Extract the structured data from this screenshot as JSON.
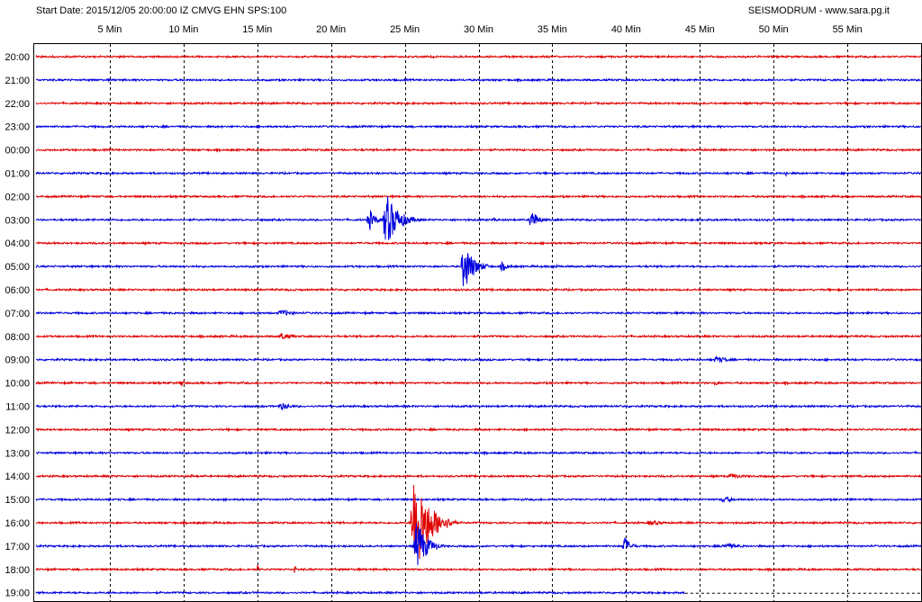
{
  "header": {
    "start_info": "Start Date: 2015/12/05 20:00:00 IZ CMVG EHN SPS:100",
    "source": "SEISMODRUM - www.sara.pg.it"
  },
  "colors": {
    "even_trace": "#e00000",
    "odd_trace": "#0000dd",
    "grid": "#000000",
    "frame": "#000000",
    "background": "#ffffff"
  },
  "chart_data": {
    "type": "line",
    "title": "",
    "minute_ticks": [
      "5 Min",
      "10 Min",
      "15 Min",
      "20 Min",
      "25 Min",
      "30 Min",
      "35 Min",
      "40 Min",
      "45 Min",
      "50 Min",
      "55 Min"
    ],
    "minute_values": [
      5,
      10,
      15,
      20,
      25,
      30,
      35,
      40,
      45,
      50,
      55
    ],
    "x_range_min": [
      0,
      60
    ],
    "grid": "dashed vertical lines every 5 minutes",
    "rows": [
      "20:00",
      "21:00",
      "22:00",
      "23:00",
      "00:00",
      "01:00",
      "02:00",
      "03:00",
      "04:00",
      "05:00",
      "06:00",
      "07:00",
      "08:00",
      "09:00",
      "10:00",
      "11:00",
      "12:00",
      "13:00",
      "14:00",
      "15:00",
      "16:00",
      "17:00",
      "18:00",
      "19:00"
    ],
    "row_color_pattern": "alternating red / blue starting with red",
    "last_row_recorded_until_min": 44,
    "events": [
      {
        "row": "01:00",
        "minute": 50.8,
        "amplitude": 4,
        "duration_min": 0.4
      },
      {
        "row": "03:00",
        "minute": 22.5,
        "amplitude": 14,
        "duration_min": 1.2
      },
      {
        "row": "03:00",
        "minute": 23.6,
        "amplitude": 30,
        "duration_min": 2.5
      },
      {
        "row": "03:00",
        "minute": 31.0,
        "amplitude": 3,
        "duration_min": 0.8
      },
      {
        "row": "03:00",
        "minute": 33.5,
        "amplitude": 14,
        "duration_min": 1.2
      },
      {
        "row": "05:00",
        "minute": 28.9,
        "amplitude": 29,
        "duration_min": 2.0
      },
      {
        "row": "05:00",
        "minute": 31.5,
        "amplitude": 6,
        "duration_min": 1.2
      },
      {
        "row": "05:00",
        "minute": 35.0,
        "amplitude": 2,
        "duration_min": 2.5
      },
      {
        "row": "07:00",
        "minute": 16.5,
        "amplitude": 4,
        "duration_min": 2.5
      },
      {
        "row": "08:00",
        "minute": 16.5,
        "amplitude": 4,
        "duration_min": 2.5
      },
      {
        "row": "09:00",
        "minute": 46.0,
        "amplitude": 4,
        "duration_min": 2.5
      },
      {
        "row": "10:00",
        "minute": 9.8,
        "amplitude": 5,
        "duration_min": 0.8
      },
      {
        "row": "10:00",
        "minute": 46.0,
        "amplitude": 3,
        "duration_min": 1.0
      },
      {
        "row": "11:00",
        "minute": 16.5,
        "amplitude": 4,
        "duration_min": 2.5
      },
      {
        "row": "11:00",
        "minute": 40.0,
        "amplitude": 4,
        "duration_min": 0.3
      },
      {
        "row": "14:00",
        "minute": 10.5,
        "amplitude": 4,
        "duration_min": 0.3
      },
      {
        "row": "14:00",
        "minute": 47.0,
        "amplitude": 3,
        "duration_min": 3.0
      },
      {
        "row": "15:00",
        "minute": 46.5,
        "amplitude": 4,
        "duration_min": 2.0
      },
      {
        "row": "16:00",
        "minute": 25.5,
        "amplitude": 60,
        "duration_min": 3.0
      },
      {
        "row": "16:00",
        "minute": 41.5,
        "amplitude": 3,
        "duration_min": 3.0
      },
      {
        "row": "17:00",
        "minute": 25.7,
        "amplitude": 30,
        "duration_min": 2.0
      },
      {
        "row": "17:00",
        "minute": 39.8,
        "amplitude": 12,
        "duration_min": 1.2
      },
      {
        "row": "17:00",
        "minute": 46.5,
        "amplitude": 3,
        "duration_min": 4.0
      },
      {
        "row": "18:00",
        "minute": 15.0,
        "amplitude": 6,
        "duration_min": 0.3
      },
      {
        "row": "18:00",
        "minute": 17.5,
        "amplitude": 6,
        "duration_min": 0.3
      }
    ]
  }
}
